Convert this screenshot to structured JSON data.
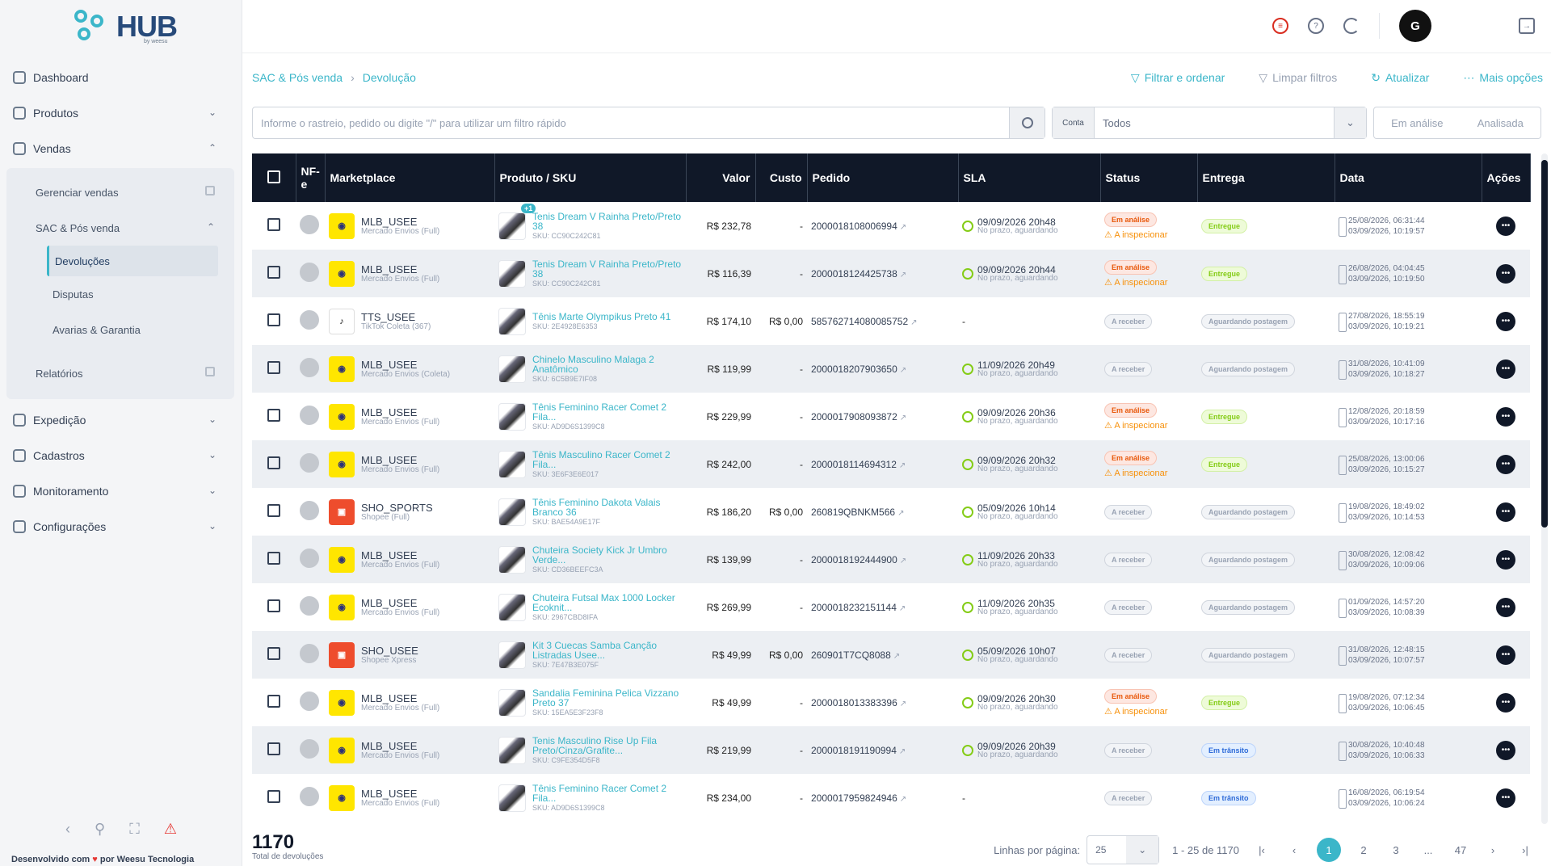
{
  "app": {
    "logo": "HUB",
    "logo_sub": "by weesu"
  },
  "sidebar": {
    "items": [
      {
        "label": "Dashboard",
        "icon": "dashboard-icon"
      },
      {
        "label": "Produtos",
        "icon": "box-icon"
      },
      {
        "label": "Vendas",
        "icon": "sales-icon"
      }
    ],
    "vendas_sub": [
      {
        "label": "Gerenciar vendas"
      },
      {
        "label": "SAC & Pós venda"
      },
      {
        "label": "Devoluções"
      },
      {
        "label": "Disputas"
      },
      {
        "label": "Avarias & Garantia"
      },
      {
        "label": "Relatórios"
      }
    ],
    "items2": [
      {
        "label": "Expedição",
        "icon": "truck-icon"
      },
      {
        "label": "Cadastros",
        "icon": "database-icon"
      },
      {
        "label": "Monitoramento",
        "icon": "monitor-icon"
      },
      {
        "label": "Configurações",
        "icon": "gear-icon"
      }
    ],
    "credit_prefix": "Desenvolvido com",
    "credit_suffix": "por Weesu Tecnologia"
  },
  "topbar": {
    "avatar": "G"
  },
  "breadcrumb": {
    "first": "SAC & Pós venda",
    "second": "Devolução"
  },
  "actions": {
    "filter": "Filtrar e ordenar",
    "clear": "Limpar filtros",
    "refresh": "Atualizar",
    "more": "Mais opções"
  },
  "search": {
    "placeholder": "Informe o rastreio, pedido ou digite \"/\" para utilizar um filtro rápido"
  },
  "contas": {
    "label": "Conta",
    "value": "Todos"
  },
  "segment": {
    "a": "Em análise",
    "b": "Analisada"
  },
  "table": {
    "headers": {
      "nfe": "NF-e",
      "marketplace": "Marketplace",
      "produto": "Produto / SKU",
      "valor": "Valor",
      "custo": "Custo",
      "pedido": "Pedido",
      "sla": "SLA",
      "status": "Status",
      "entrega": "Entrega",
      "data": "Data",
      "acoes": "Ações"
    },
    "rows": [
      {
        "mp": "ml",
        "mp_name": "MLB_USEE",
        "mp_sub": "Mercado Envios (Full)",
        "plus": "+1",
        "prod": "Tenis Dream V Rainha Preto/Preto 38",
        "sku": "SKU: CC90C242C81",
        "valor": "R$ 232,78",
        "custo": "-",
        "pedido": "2000018108006994",
        "sla_d": "09/09/2026 20h48",
        "sla_s": "No prazo, aguardando",
        "status": "Em análise",
        "status_k": "ana",
        "insp": "A inspecionar",
        "entrega": "Entregue",
        "entrega_k": "ent",
        "d1": "25/08/2026, 06:31:44",
        "d2": "03/09/2026, 10:19:57"
      },
      {
        "mp": "ml",
        "mp_name": "MLB_USEE",
        "mp_sub": "Mercado Envios (Full)",
        "plus": "",
        "prod": "Tenis Dream V Rainha Preto/Preto 38",
        "sku": "SKU: CC90C242C81",
        "valor": "R$ 116,39",
        "custo": "-",
        "pedido": "2000018124425738",
        "sla_d": "09/09/2026 20h44",
        "sla_s": "No prazo, aguardando",
        "status": "Em análise",
        "status_k": "ana",
        "insp": "A inspecionar",
        "entrega": "Entregue",
        "entrega_k": "ent",
        "d1": "26/08/2026, 04:04:45",
        "d2": "03/09/2026, 10:19:50"
      },
      {
        "mp": "tt",
        "mp_name": "TTS_USEE",
        "mp_sub": "TikTok Coleta (367)",
        "plus": "",
        "prod": "Tênis Marte Olympikus Preto 41",
        "sku": "SKU: 2E4928E6353",
        "valor": "R$ 174,10",
        "custo": "R$ 0,00",
        "pedido": "585762714080085752",
        "sla_d": "-",
        "sla_s": "",
        "status": "A receber",
        "status_k": "rec",
        "insp": "",
        "entrega": "Aguardando postagem",
        "entrega_k": "agu",
        "d1": "27/08/2026, 18:55:19",
        "d2": "03/09/2026, 10:19:21"
      },
      {
        "mp": "ml",
        "mp_name": "MLB_USEE",
        "mp_sub": "Mercado Envios (Coleta)",
        "plus": "",
        "prod": "Chinelo Masculino Malaga 2 Anatômico",
        "sku": "SKU: 6C5B9E7IF08",
        "valor": "R$ 119,99",
        "custo": "-",
        "pedido": "2000018207903650",
        "sla_d": "11/09/2026 20h49",
        "sla_s": "No prazo, aguardando",
        "status": "A receber",
        "status_k": "rec",
        "insp": "",
        "entrega": "Aguardando postagem",
        "entrega_k": "agu",
        "d1": "31/08/2026, 10:41:09",
        "d2": "03/09/2026, 10:18:27"
      },
      {
        "mp": "ml",
        "mp_name": "MLB_USEE",
        "mp_sub": "Mercado Envios (Full)",
        "plus": "",
        "prod": "Tênis Feminino Racer Comet 2 Fila...",
        "sku": "SKU: AD9D6S1399C8",
        "valor": "R$ 229,99",
        "custo": "-",
        "pedido": "2000017908093872",
        "sla_d": "09/09/2026 20h36",
        "sla_s": "No prazo, aguardando",
        "status": "Em análise",
        "status_k": "ana",
        "insp": "A inspecionar",
        "entrega": "Entregue",
        "entrega_k": "ent",
        "d1": "12/08/2026, 20:18:59",
        "d2": "03/09/2026, 10:17:16"
      },
      {
        "mp": "ml",
        "mp_name": "MLB_USEE",
        "mp_sub": "Mercado Envios (Full)",
        "plus": "",
        "prod": "Tênis Masculino Racer Comet 2 Fila...",
        "sku": "SKU: 3E6F3E6E017",
        "valor": "R$ 242,00",
        "custo": "-",
        "pedido": "2000018114694312",
        "sla_d": "09/09/2026 20h32",
        "sla_s": "No prazo, aguardando",
        "status": "Em análise",
        "status_k": "ana",
        "insp": "A inspecionar",
        "entrega": "Entregue",
        "entrega_k": "ent",
        "d1": "25/08/2026, 13:00:06",
        "d2": "03/09/2026, 10:15:27"
      },
      {
        "mp": "sp",
        "mp_name": "SHO_SPORTS",
        "mp_sub": "Shopee (Full)",
        "plus": "",
        "prod": "Tênis Feminino Dakota Valais Branco 36",
        "sku": "SKU: BAE54A9E17F",
        "valor": "R$ 186,20",
        "custo": "R$ 0,00",
        "pedido": "260819QBNKM566",
        "sla_d": "05/09/2026 10h14",
        "sla_s": "No prazo, aguardando",
        "status": "A receber",
        "status_k": "rec",
        "insp": "",
        "entrega": "Aguardando postagem",
        "entrega_k": "agu",
        "d1": "19/08/2026, 18:49:02",
        "d2": "03/09/2026, 10:14:53"
      },
      {
        "mp": "ml",
        "mp_name": "MLB_USEE",
        "mp_sub": "Mercado Envios (Full)",
        "plus": "",
        "prod": "Chuteira Society Kick Jr Umbro Verde...",
        "sku": "SKU: CD36BEEFC3A",
        "valor": "R$ 139,99",
        "custo": "-",
        "pedido": "2000018192444900",
        "sla_d": "11/09/2026 20h33",
        "sla_s": "No prazo, aguardando",
        "status": "A receber",
        "status_k": "rec",
        "insp": "",
        "entrega": "Aguardando postagem",
        "entrega_k": "agu",
        "d1": "30/08/2026, 12:08:42",
        "d2": "03/09/2026, 10:09:06"
      },
      {
        "mp": "ml",
        "mp_name": "MLB_USEE",
        "mp_sub": "Mercado Envios (Full)",
        "plus": "",
        "prod": "Chuteira Futsal Max 1000 Locker Ecoknit...",
        "sku": "SKU: 2967CBD8IFA",
        "valor": "R$ 269,99",
        "custo": "-",
        "pedido": "2000018232151144",
        "sla_d": "11/09/2026 20h35",
        "sla_s": "No prazo, aguardando",
        "status": "A receber",
        "status_k": "rec",
        "insp": "",
        "entrega": "Aguardando postagem",
        "entrega_k": "agu",
        "d1": "01/09/2026, 14:57:20",
        "d2": "03/09/2026, 10:08:39"
      },
      {
        "mp": "sp",
        "mp_name": "SHO_USEE",
        "mp_sub": "Shopee Xpress",
        "plus": "",
        "prod": "Kit 3 Cuecas Samba Canção Listradas Usee...",
        "sku": "SKU: 7E47B3E075F",
        "valor": "R$ 49,99",
        "custo": "R$ 0,00",
        "pedido": "260901T7CQ8088",
        "sla_d": "05/09/2026 10h07",
        "sla_s": "No prazo, aguardando",
        "status": "A receber",
        "status_k": "rec",
        "insp": "",
        "entrega": "Aguardando postagem",
        "entrega_k": "agu",
        "d1": "31/08/2026, 12:48:15",
        "d2": "03/09/2026, 10:07:57"
      },
      {
        "mp": "ml",
        "mp_name": "MLB_USEE",
        "mp_sub": "Mercado Envios (Full)",
        "plus": "",
        "prod": "Sandalia Feminina Pelica Vizzano Preto 37",
        "sku": "SKU: 15EA5E3F23F8",
        "valor": "R$ 49,99",
        "custo": "-",
        "pedido": "2000018013383396",
        "sla_d": "09/09/2026 20h30",
        "sla_s": "No prazo, aguardando",
        "status": "Em análise",
        "status_k": "ana",
        "insp": "A inspecionar",
        "entrega": "Entregue",
        "entrega_k": "ent",
        "d1": "19/08/2026, 07:12:34",
        "d2": "03/09/2026, 10:06:45"
      },
      {
        "mp": "ml",
        "mp_name": "MLB_USEE",
        "mp_sub": "Mercado Envios (Full)",
        "plus": "",
        "prod": "Tenis Masculino Rise Up Fila Preto/Cinza/Grafite...",
        "sku": "SKU: C9FE354D5F8",
        "valor": "R$ 219,99",
        "custo": "-",
        "pedido": "2000018191190994",
        "sla_d": "09/09/2026 20h39",
        "sla_s": "No prazo, aguardando",
        "status": "A receber",
        "status_k": "rec",
        "insp": "",
        "entrega": "Em trânsito",
        "entrega_k": "tra",
        "d1": "30/08/2026, 10:40:48",
        "d2": "03/09/2026, 10:06:33"
      },
      {
        "mp": "ml",
        "mp_name": "MLB_USEE",
        "mp_sub": "Mercado Envios (Full)",
        "plus": "",
        "prod": "Tênis Feminino Racer Comet 2 Fila...",
        "sku": "SKU: AD9D6S1399C8",
        "valor": "R$ 234,00",
        "custo": "-",
        "pedido": "2000017959824946",
        "sla_d": "-",
        "sla_s": "",
        "status": "A receber",
        "status_k": "rec",
        "insp": "",
        "entrega": "Em trânsito",
        "entrega_k": "tra",
        "d1": "16/08/2026, 06:19:54",
        "d2": "03/09/2026, 10:06:24"
      }
    ]
  },
  "footer": {
    "total": "1170",
    "total_label": "Total de devoluções",
    "per_page_label": "Linhas por página:",
    "per_page": "25",
    "range": "1 - 25 de 1170",
    "pages": [
      "1",
      "2",
      "3",
      "...",
      "47"
    ]
  },
  "colors": {
    "accent": "#3bb6c9",
    "header_bg": "#101828"
  }
}
